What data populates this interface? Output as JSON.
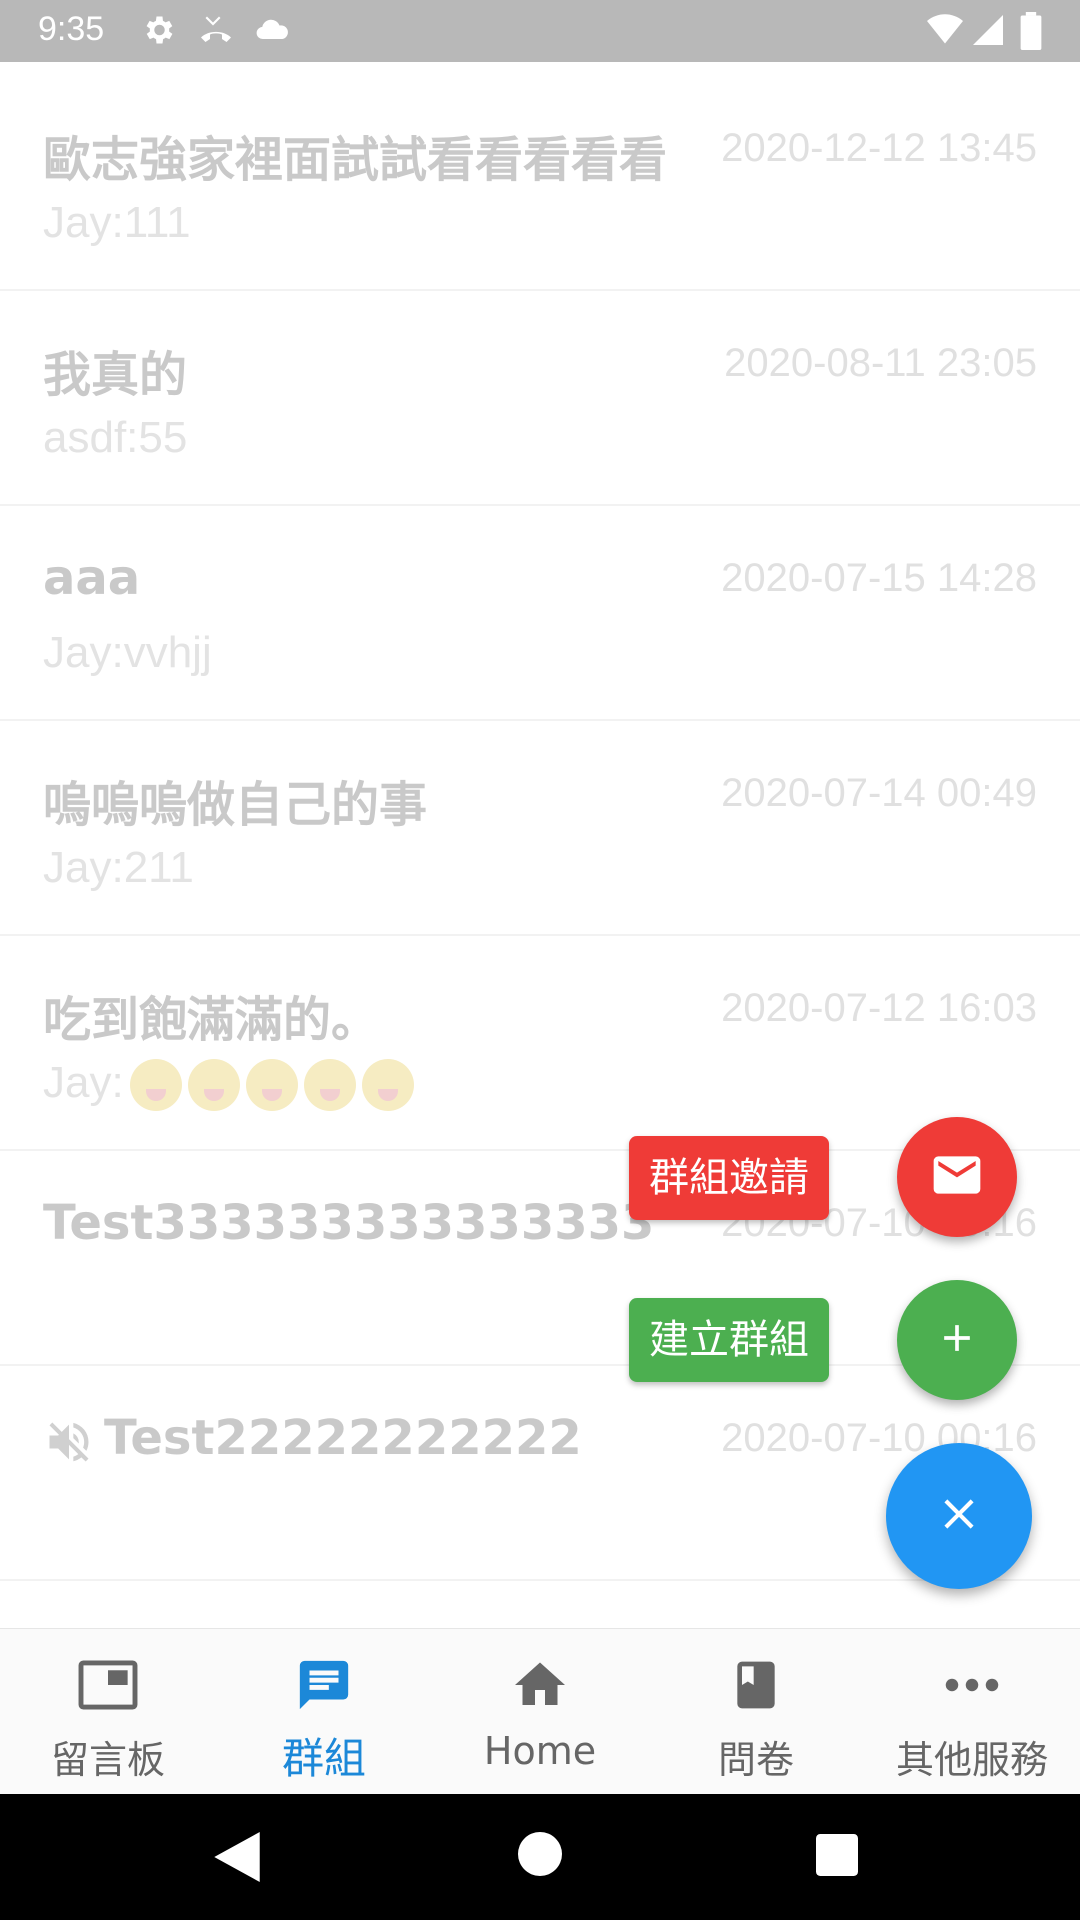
{
  "status_bar": {
    "time": "9:35",
    "icons": [
      "gear-icon",
      "missed-call-icon",
      "cloud-icon",
      "wifi-icon",
      "signal-icon",
      "battery-icon"
    ]
  },
  "conversations": [
    {
      "title": "歐志強家裡面試試看看看看看",
      "time": "2020-12-12 13:45",
      "preview": "Jay:111",
      "muted": false
    },
    {
      "title": "我真的",
      "time": "2020-08-11 23:05",
      "preview": "asdf:55",
      "muted": false
    },
    {
      "title": "aaa",
      "time": "2020-07-15 14:28",
      "preview": "Jay:vvhjj",
      "muted": false
    },
    {
      "title": "嗚嗚嗚做自己的事",
      "time": "2020-07-14 00:49",
      "preview": "Jay:211",
      "muted": false
    },
    {
      "title": "吃到飽滿滿的。",
      "time": "2020-07-12 16:03",
      "preview": "Jay:",
      "muted": false
    },
    {
      "title": "Test333333333333333",
      "time": "2020-07-10 00:16",
      "preview": "",
      "muted": false
    },
    {
      "title": "Test22222222222",
      "time": "2020-07-10 00:16",
      "preview": "",
      "muted": true
    }
  ],
  "speed_dial": {
    "invite_label": "群組邀請",
    "create_label": "建立群組",
    "invite_color": "#ef3b37",
    "create_color": "#4caf50",
    "main_color": "#2196f3"
  },
  "bottom_nav": {
    "items": [
      {
        "label": "留言板",
        "icon": "board-icon",
        "active": false
      },
      {
        "label": "群組",
        "icon": "chat-icon",
        "active": true
      },
      {
        "label": "Home",
        "icon": "home-icon",
        "active": false
      },
      {
        "label": "問卷",
        "icon": "book-icon",
        "active": false
      },
      {
        "label": "其他服務",
        "icon": "more-icon",
        "active": false
      }
    ],
    "active_color": "#1c88d8"
  }
}
